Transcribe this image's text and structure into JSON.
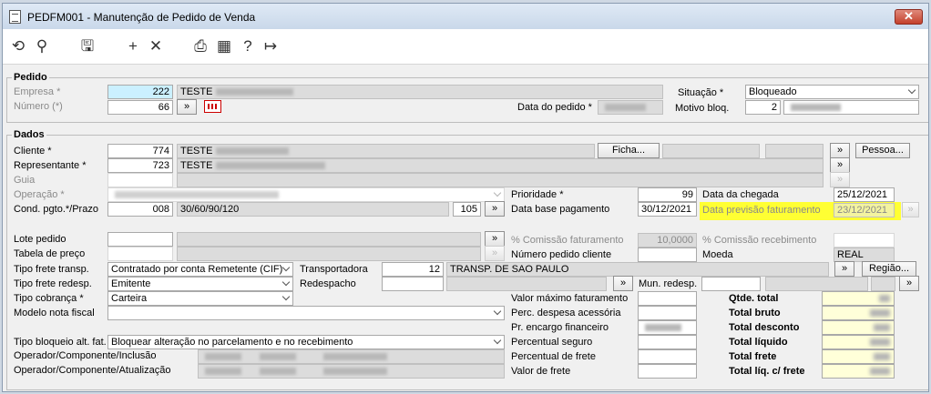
{
  "window": {
    "title": "PEDFM001 - Manutenção de Pedido de Venda",
    "close_label": "✕"
  },
  "toolbar": [
    {
      "name": "undo-icon",
      "glyph": "⟲"
    },
    {
      "name": "search-icon",
      "glyph": "⚲"
    },
    {
      "name": "save-icon",
      "glyph": "🖫"
    },
    {
      "name": "add-icon",
      "glyph": "+"
    },
    {
      "name": "delete-icon",
      "glyph": "✕"
    },
    {
      "name": "print-icon",
      "glyph": "⎙"
    },
    {
      "name": "calendar-icon",
      "glyph": "▦"
    },
    {
      "name": "help-icon",
      "glyph": "?"
    },
    {
      "name": "exit-icon",
      "glyph": "↦"
    }
  ],
  "pedido": {
    "title": "Pedido",
    "empresa_label": "Empresa *",
    "empresa_code": "222",
    "empresa_name": "TESTE",
    "numero_label": "Número (*)",
    "numero_value": "66",
    "data_pedido_label": "Data do pedido *",
    "situacao_label": "Situação *",
    "situacao_value": "Bloqueado",
    "motivo_label": "Motivo bloq.",
    "motivo_code": "2"
  },
  "dados": {
    "title": "Dados",
    "cliente_label": "Cliente *",
    "cliente_code": "774",
    "cliente_name": "TESTE",
    "ficha_button": "Ficha...",
    "pessoa_button": "Pessoa...",
    "representante_label": "Representante *",
    "representante_code": "723",
    "representante_name": "TESTE",
    "guia_label": "Guia",
    "operacao_label": "Operação *",
    "cond_pgto_label": "Cond. pgto.*/Prazo",
    "cond_pgto_code": "008",
    "cond_pgto_value": "30/60/90/120",
    "prazo_value": "105",
    "prioridade_label": "Prioridade *",
    "prioridade_value": "99",
    "data_base_label": "Data base pagamento",
    "data_base_value": "30/12/2021",
    "data_chegada_label": "Data da chegada",
    "data_chegada_value": "25/12/2021",
    "data_prev_fat_label": "Data previsão faturamento",
    "data_prev_fat_value": "23/12/2021",
    "lote_label": "Lote pedido",
    "tabela_label": "Tabela de preço",
    "comissao_fat_label": "% Comissão faturamento",
    "comissao_fat_value": "10,0000",
    "comissao_rec_label": "% Comissão recebimento",
    "num_pedido_cliente_label": "Número pedido cliente",
    "moeda_label": "Moeda",
    "moeda_value": "REAL",
    "tipo_frete_label": "Tipo frete transp.",
    "tipo_frete_value": "Contratado por conta Remetente (CIF)",
    "transportadora_label": "Transportadora",
    "transportadora_code": "12",
    "transportadora_name": "TRANSP. DE SAO PAULO",
    "regiao_button": "Região...",
    "tipo_frete_redesp_label": "Tipo frete redesp.",
    "tipo_frete_redesp_value": "Emitente",
    "redespacho_label": "Redespacho",
    "mun_redesp_label": "Mun. redesp.",
    "tipo_cobranca_label": "Tipo cobrança *",
    "tipo_cobranca_value": "Carteira",
    "modelo_nf_label": "Modelo nota fiscal",
    "tipo_bloqueio_label": "Tipo bloqueio alt. fat.",
    "tipo_bloqueio_value": "Bloquear alteração no parcelamento e no recebimento",
    "operador_inclusao_label": "Operador/Componente/Inclusão",
    "operador_atualizacao_label": "Operador/Componente/Atualização",
    "valor_max_fat_label": "Valor máximo faturamento",
    "perc_despesa_label": "Perc. despesa acessória",
    "pr_encargo_label": "Pr. encargo financeiro",
    "percentual_seguro_label": "Percentual seguro",
    "percentual_frete_label": "Percentual de frete",
    "valor_frete_label": "Valor de frete",
    "qtde_total_label": "Qtde. total",
    "total_bruto_label": "Total bruto",
    "total_desconto_label": "Total desconto",
    "total_liquido_label": "Total líquido",
    "total_frete_label": "Total frete",
    "total_liq_frete_label": "Total líq. c/ frete"
  },
  "lookup_glyph": "»"
}
